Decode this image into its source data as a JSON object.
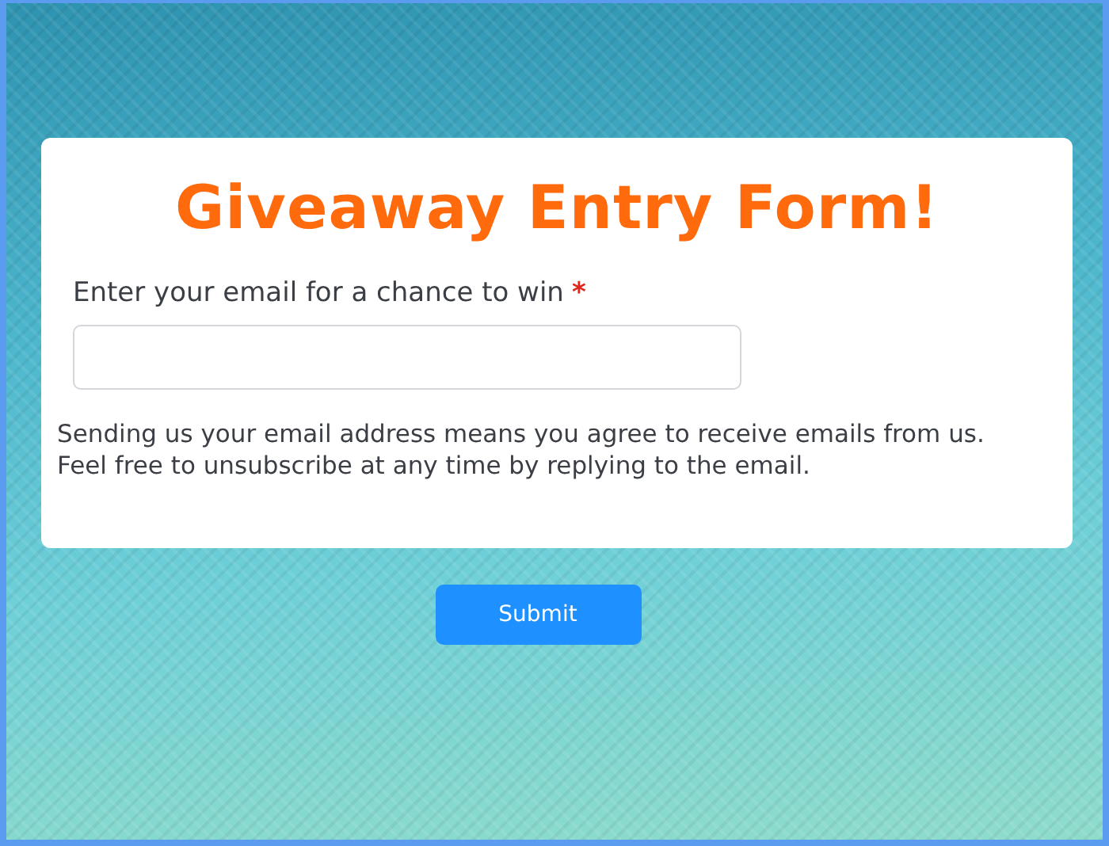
{
  "form": {
    "title": "Giveaway Entry Form!",
    "field": {
      "label": "Enter your email for a chance to win",
      "required_mark": "*"
    },
    "notice": "Sending us your email address means you agree to receive emails from us. Feel free to unsubscribe at any time by replying to the email."
  },
  "submit_button": "Submit"
}
